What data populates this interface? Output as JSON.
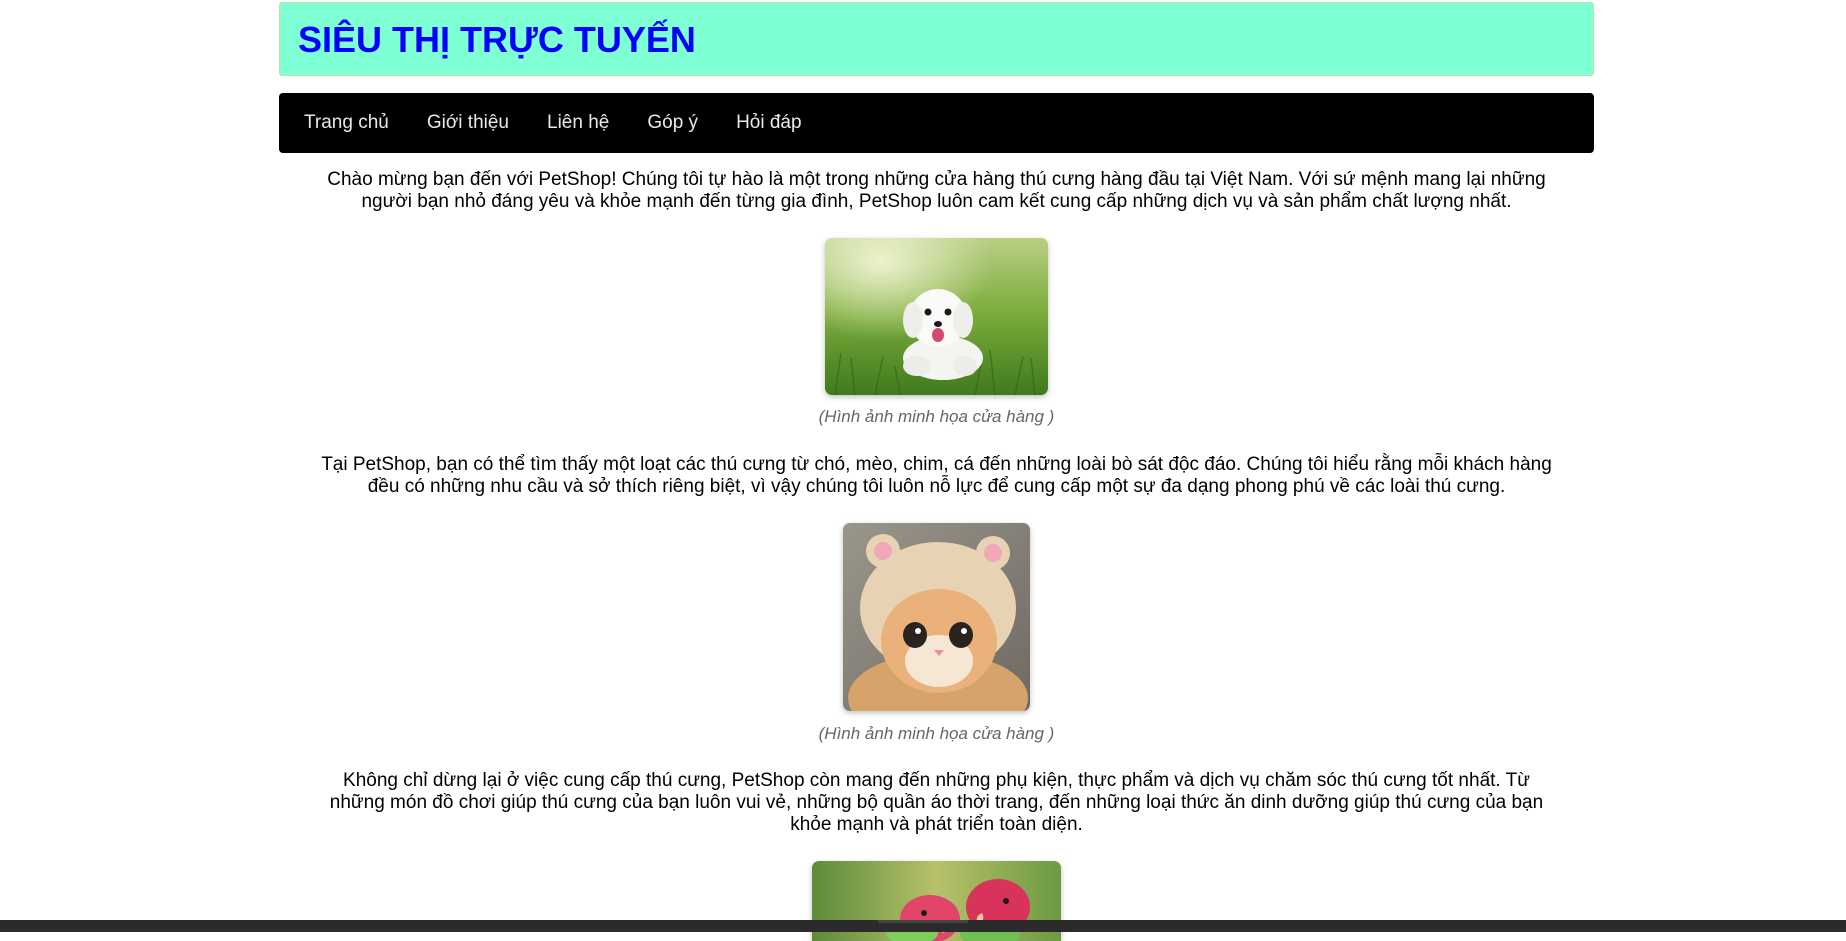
{
  "header": {
    "title": "SIÊU THỊ TRỰC TUYẾN"
  },
  "nav": {
    "items": [
      {
        "label": "Trang chủ"
      },
      {
        "label": "Giới thiệu"
      },
      {
        "label": "Liên hệ"
      },
      {
        "label": "Góp ý"
      },
      {
        "label": "Hỏi đáp"
      }
    ]
  },
  "content": {
    "intro_line1": "Chào mừng bạn đến với PetShop! Chúng tôi tự hào là một trong những cửa hàng thú cưng hàng đầu tại Việt Nam. Với sứ mệnh mang lại những",
    "intro_line2": "người bạn nhỏ đáng yêu và khỏe mạnh đến từng gia đình, PetShop luôn cam kết cung cấp những dịch vụ và sản phẩm chất lượng nhất.",
    "caption1": "(Hình ảnh minh họa cửa hàng )",
    "para2_line1": "Tại PetShop, bạn có thể tìm thấy một loạt các thú cưng từ chó, mèo, chim, cá đến những loài bò sát độc đáo. Chúng tôi hiểu rằng mỗi khách hàng",
    "para2_line2": "đều có những nhu cầu và sở thích riêng biệt, vì vậy chúng tôi luôn nỗ lực để cung cấp một sự đa dạng phong phú về các loài thú cưng.",
    "caption2": "(Hình ảnh minh họa cửa hàng )",
    "para3_line1": "Không chỉ dừng lại ở việc cung cấp thú cưng, PetShop còn mang đến những phụ kiện, thực phẩm và dịch vụ chăm sóc thú cưng tốt nhất. Từ",
    "para3_line2": "những món đồ chơi giúp thú cưng của bạn luôn vui vẻ, những bộ quần áo thời trang, đến những loại thức ăn dinh dưỡng giúp thú cưng của bạn",
    "para3_line3": "khỏe mạnh và phát triển toàn diện."
  },
  "colors": {
    "header_bg": "#7fffd4",
    "header_title": "#0000ff",
    "nav_bg": "#000000",
    "nav_text": "#e8e8e8",
    "caption": "#666666"
  },
  "images": {
    "dog": "white-puppy-photo",
    "cat": "cat-in-bear-hat-photo",
    "birds": "lovebirds-photo"
  }
}
